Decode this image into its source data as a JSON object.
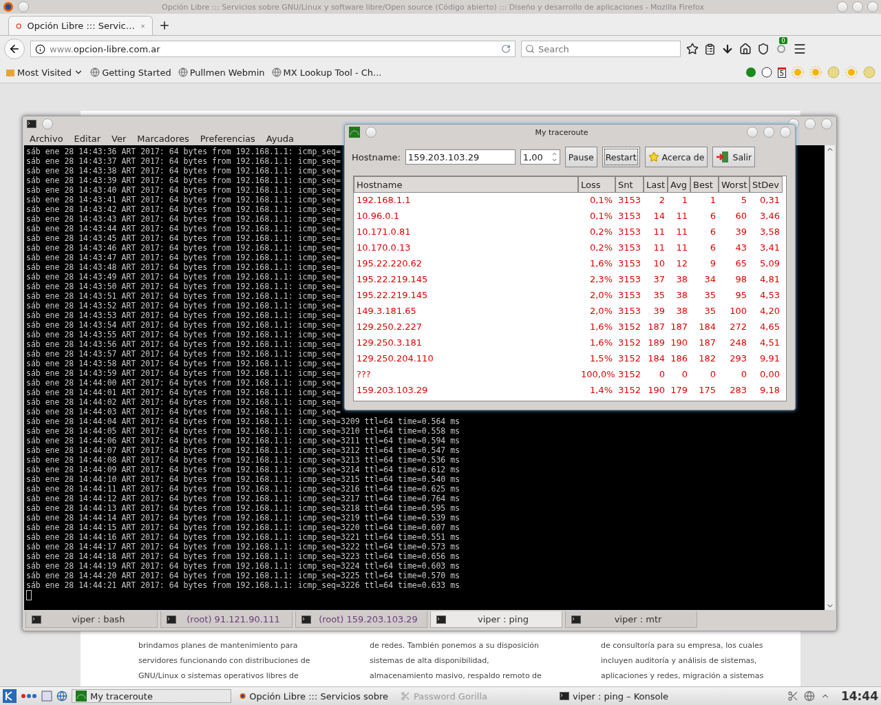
{
  "firefox": {
    "window_title": "Opción Libre ::: Servicios sobre GNU/Linux y software libre/Open source (Código abierto) ::: Diseño y desarrollo de aplicaciones - Mozilla Firefox",
    "tabs": [
      {
        "label": "Opción Libre ::: Servic…",
        "selected": true
      }
    ],
    "url_prefix": "www.",
    "url_domain": "opcion-libre.com.ar",
    "search": {
      "placeholder": "Search"
    },
    "sync_badge": "0",
    "bookmarks": [
      "Most Visited",
      "Getting Started",
      "Pullmen Webmin",
      "MX Lookup Tool - Ch..."
    ],
    "calendar_day": "5",
    "page_columns": [
      [
        "brindamos planes de mantenimiento para",
        "servidores funcionando con distribuciones de",
        "GNU/Linux o sistemas operativos libres de"
      ],
      [
        "de redes. También ponemos a su disposición",
        "sistemas de alta disponibilidad,",
        "almacenamiento masivo, respaldo remoto de"
      ],
      [
        "de consultoría para su empresa, los cuales",
        "incluyen auditoría y análisis de sistemas,",
        "aplicaciones y redes, migración a sistemas"
      ]
    ]
  },
  "konsole": {
    "menu": [
      "Archivo",
      "Editar",
      "Ver",
      "Marcadores",
      "Preferencias",
      "Ayuda"
    ],
    "lines": [
      "sáb ene 28 14:43:36 ART 2017: 64 bytes from 192.168.1.1: icmp_seq=",
      "sáb ene 28 14:43:37 ART 2017: 64 bytes from 192.168.1.1: icmp_seq=",
      "sáb ene 28 14:43:38 ART 2017: 64 bytes from 192.168.1.1: icmp_seq=",
      "sáb ene 28 14:43:39 ART 2017: 64 bytes from 192.168.1.1: icmp_seq=",
      "sáb ene 28 14:43:40 ART 2017: 64 bytes from 192.168.1.1: icmp_seq=",
      "sáb ene 28 14:43:41 ART 2017: 64 bytes from 192.168.1.1: icmp_seq=",
      "sáb ene 28 14:43:42 ART 2017: 64 bytes from 192.168.1.1: icmp_seq=",
      "sáb ene 28 14:43:43 ART 2017: 64 bytes from 192.168.1.1: icmp_seq=",
      "sáb ene 28 14:43:44 ART 2017: 64 bytes from 192.168.1.1: icmp_seq=",
      "sáb ene 28 14:43:45 ART 2017: 64 bytes from 192.168.1.1: icmp_seq=",
      "sáb ene 28 14:43:46 ART 2017: 64 bytes from 192.168.1.1: icmp_seq=",
      "sáb ene 28 14:43:47 ART 2017: 64 bytes from 192.168.1.1: icmp_seq=",
      "sáb ene 28 14:43:48 ART 2017: 64 bytes from 192.168.1.1: icmp_seq=",
      "sáb ene 28 14:43:49 ART 2017: 64 bytes from 192.168.1.1: icmp_seq=",
      "sáb ene 28 14:43:50 ART 2017: 64 bytes from 192.168.1.1: icmp_seq=",
      "sáb ene 28 14:43:51 ART 2017: 64 bytes from 192.168.1.1: icmp_seq=",
      "sáb ene 28 14:43:52 ART 2017: 64 bytes from 192.168.1.1: icmp_seq=",
      "sáb ene 28 14:43:53 ART 2017: 64 bytes from 192.168.1.1: icmp_seq=",
      "sáb ene 28 14:43:54 ART 2017: 64 bytes from 192.168.1.1: icmp_seq=",
      "sáb ene 28 14:43:55 ART 2017: 64 bytes from 192.168.1.1: icmp_seq=",
      "sáb ene 28 14:43:56 ART 2017: 64 bytes from 192.168.1.1: icmp_seq=",
      "sáb ene 28 14:43:57 ART 2017: 64 bytes from 192.168.1.1: icmp_seq=",
      "sáb ene 28 14:43:58 ART 2017: 64 bytes from 192.168.1.1: icmp_seq=",
      "sáb ene 28 14:43:59 ART 2017: 64 bytes from 192.168.1.1: icmp_seq=",
      "sáb ene 28 14:44:00 ART 2017: 64 bytes from 192.168.1.1: icmp_seq=",
      "sáb ene 28 14:44:01 ART 2017: 64 bytes from 192.168.1.1: icmp_seq=",
      "sáb ene 28 14:44:02 ART 2017: 64 bytes from 192.168.1.1: icmp_seq=",
      "sáb ene 28 14:44:03 ART 2017: 64 bytes from 192.168.1.1: icmp_seq=",
      "sáb ene 28 14:44:04 ART 2017: 64 bytes from 192.168.1.1: icmp_seq=3209 ttl=64 time=0.564 ms",
      "sáb ene 28 14:44:05 ART 2017: 64 bytes from 192.168.1.1: icmp_seq=3210 ttl=64 time=0.558 ms",
      "sáb ene 28 14:44:06 ART 2017: 64 bytes from 192.168.1.1: icmp_seq=3211 ttl=64 time=0.594 ms",
      "sáb ene 28 14:44:07 ART 2017: 64 bytes from 192.168.1.1: icmp_seq=3212 ttl=64 time=0.547 ms",
      "sáb ene 28 14:44:08 ART 2017: 64 bytes from 192.168.1.1: icmp_seq=3213 ttl=64 time=0.536 ms",
      "sáb ene 28 14:44:09 ART 2017: 64 bytes from 192.168.1.1: icmp_seq=3214 ttl=64 time=0.612 ms",
      "sáb ene 28 14:44:10 ART 2017: 64 bytes from 192.168.1.1: icmp_seq=3215 ttl=64 time=0.540 ms",
      "sáb ene 28 14:44:11 ART 2017: 64 bytes from 192.168.1.1: icmp_seq=3216 ttl=64 time=0.625 ms",
      "sáb ene 28 14:44:12 ART 2017: 64 bytes from 192.168.1.1: icmp_seq=3217 ttl=64 time=0.764 ms",
      "sáb ene 28 14:44:13 ART 2017: 64 bytes from 192.168.1.1: icmp_seq=3218 ttl=64 time=0.595 ms",
      "sáb ene 28 14:44:14 ART 2017: 64 bytes from 192.168.1.1: icmp_seq=3219 ttl=64 time=0.539 ms",
      "sáb ene 28 14:44:15 ART 2017: 64 bytes from 192.168.1.1: icmp_seq=3220 ttl=64 time=0.607 ms",
      "sáb ene 28 14:44:16 ART 2017: 64 bytes from 192.168.1.1: icmp_seq=3221 ttl=64 time=0.551 ms",
      "sáb ene 28 14:44:17 ART 2017: 64 bytes from 192.168.1.1: icmp_seq=3222 ttl=64 time=0.573 ms",
      "sáb ene 28 14:44:18 ART 2017: 64 bytes from 192.168.1.1: icmp_seq=3223 ttl=64 time=0.656 ms",
      "sáb ene 28 14:44:19 ART 2017: 64 bytes from 192.168.1.1: icmp_seq=3224 ttl=64 time=0.603 ms",
      "sáb ene 28 14:44:20 ART 2017: 64 bytes from 192.168.1.1: icmp_seq=3225 ttl=64 time=0.570 ms",
      "sáb ene 28 14:44:21 ART 2017: 64 bytes from 192.168.1.1: icmp_seq=3226 ttl=64 time=0.633 ms"
    ],
    "tabs": [
      {
        "label": "viper : bash",
        "selected": false,
        "color": "#303030"
      },
      {
        "label": "(root) 91.121.90.111",
        "selected": false,
        "color": "#6b3a78"
      },
      {
        "label": "(root) 159.203.103.29",
        "selected": false,
        "color": "#6b3a78"
      },
      {
        "label": "viper : ping",
        "selected": true,
        "color": "#303030"
      },
      {
        "label": "viper : mtr",
        "selected": false,
        "color": "#303030"
      }
    ]
  },
  "mtr": {
    "title": "My traceroute",
    "hostname_label": "Hostname:",
    "hostname": "159.203.103.29",
    "interval": "1,00",
    "buttons": [
      {
        "label": "Pause",
        "kind": "plain",
        "focused": false
      },
      {
        "label": "Restart",
        "kind": "plain",
        "focused": true
      },
      {
        "label": "Acerca de",
        "kind": "star",
        "focused": false
      },
      {
        "label": "Salir",
        "kind": "exit",
        "focused": false
      }
    ],
    "columns": [
      "Hostname",
      "Loss",
      "Snt",
      "Last",
      "Avg",
      "Best",
      "Worst",
      "StDev"
    ],
    "rows": [
      [
        "192.168.1.1",
        "0,1%",
        "3153",
        "2",
        "1",
        "1",
        "5",
        "0,31"
      ],
      [
        "10.96.0.1",
        "0,1%",
        "3153",
        "14",
        "11",
        "6",
        "60",
        "3,46"
      ],
      [
        "10.171.0.81",
        "0,2%",
        "3153",
        "11",
        "11",
        "6",
        "39",
        "3,58"
      ],
      [
        "10.170.0.13",
        "0,2%",
        "3153",
        "11",
        "11",
        "6",
        "43",
        "3,41"
      ],
      [
        "195.22.220.62",
        "1,6%",
        "3153",
        "10",
        "12",
        "9",
        "65",
        "5,09"
      ],
      [
        "195.22.219.145",
        "2,3%",
        "3153",
        "37",
        "38",
        "34",
        "98",
        "4,81"
      ],
      [
        "195.22.219.145",
        "2,0%",
        "3153",
        "35",
        "38",
        "35",
        "95",
        "4,53"
      ],
      [
        "149.3.181.65",
        "2,0%",
        "3153",
        "39",
        "38",
        "35",
        "100",
        "4,20"
      ],
      [
        "129.250.2.227",
        "1,6%",
        "3152",
        "187",
        "187",
        "184",
        "272",
        "4,65"
      ],
      [
        "129.250.3.181",
        "1,6%",
        "3152",
        "189",
        "190",
        "187",
        "248",
        "4,51"
      ],
      [
        "129.250.204.110",
        "1,5%",
        "3152",
        "184",
        "186",
        "182",
        "293",
        "9,91"
      ],
      [
        "???",
        "100,0%",
        "3152",
        "0",
        "0",
        "0",
        "0",
        "0,00"
      ],
      [
        "159.203.103.29",
        "1,4%",
        "3152",
        "190",
        "179",
        "175",
        "283",
        "9,18"
      ]
    ]
  },
  "taskbar": {
    "tasks": [
      {
        "label": "My traceroute",
        "selected": true,
        "disabled": false,
        "kind": "mtr"
      },
      {
        "label": "Opción Libre ::: Servicios sobre",
        "selected": false,
        "disabled": false,
        "kind": "firefox"
      },
      {
        "label": "Password Gorilla",
        "selected": false,
        "disabled": true,
        "kind": "gorilla"
      },
      {
        "label": "viper : ping – Konsole",
        "selected": false,
        "disabled": false,
        "kind": "konsole"
      }
    ],
    "clock": "14:44"
  }
}
